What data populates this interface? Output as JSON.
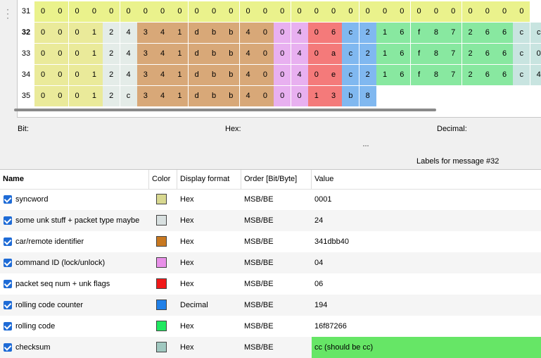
{
  "rows": [
    {
      "num": "31",
      "bold": false,
      "cells": [
        "0",
        "0",
        "0",
        "0",
        "0",
        "0",
        "0",
        "0",
        "0",
        "0",
        "0",
        "0",
        "0",
        "0",
        "0",
        "0",
        "0",
        "0",
        "0",
        "0",
        "0",
        "0",
        "0",
        "0",
        "0",
        "0",
        "0",
        "0",
        "0"
      ]
    },
    {
      "num": "32",
      "bold": true,
      "cells": [
        "0",
        "0",
        "0",
        "1",
        "2",
        "4",
        "3",
        "4",
        "1",
        "d",
        "b",
        "b",
        "4",
        "0",
        "0",
        "4",
        "0",
        "6",
        "c",
        "2",
        "1",
        "6",
        "f",
        "8",
        "7",
        "2",
        "6",
        "6",
        "c",
        "c"
      ]
    },
    {
      "num": "33",
      "bold": false,
      "cells": [
        "0",
        "0",
        "0",
        "1",
        "2",
        "4",
        "3",
        "4",
        "1",
        "d",
        "b",
        "b",
        "4",
        "0",
        "0",
        "4",
        "0",
        "a",
        "c",
        "2",
        "1",
        "6",
        "f",
        "8",
        "7",
        "2",
        "6",
        "6",
        "c",
        "0"
      ]
    },
    {
      "num": "34",
      "bold": false,
      "cells": [
        "0",
        "0",
        "0",
        "1",
        "2",
        "4",
        "3",
        "4",
        "1",
        "d",
        "b",
        "b",
        "4",
        "0",
        "0",
        "4",
        "0",
        "e",
        "c",
        "2",
        "1",
        "6",
        "f",
        "8",
        "7",
        "2",
        "6",
        "6",
        "c",
        "4"
      ]
    },
    {
      "num": "35",
      "bold": false,
      "cells": [
        "0",
        "0",
        "0",
        "1",
        "2",
        "c",
        "3",
        "4",
        "1",
        "d",
        "b",
        "b",
        "4",
        "0",
        "0",
        "0",
        "1",
        "3",
        "b",
        "8"
      ]
    }
  ],
  "info": {
    "bit_label": "Bit:",
    "hex_label": "Hex:",
    "decimal_label": "Decimal:"
  },
  "labels_title": "Labels for message #32",
  "table": {
    "headers": {
      "name": "Name",
      "color": "Color",
      "display_format": "Display format",
      "order": "Order [Bit/Byte]",
      "value": "Value"
    },
    "rows": [
      {
        "name": "syncword",
        "color": "#d8d890",
        "format": "Hex",
        "order": "MSB/BE",
        "value": "0001"
      },
      {
        "name": "some unk stuff + packet type maybe",
        "color": "#d8e0e0",
        "format": "Hex",
        "order": "MSB/BE",
        "value": "24"
      },
      {
        "name": "car/remote identifier",
        "color": "#c87820",
        "format": "Hex",
        "order": "MSB/BE",
        "value": "341dbb40"
      },
      {
        "name": "command ID (lock/unlock)",
        "color": "#e890e8",
        "format": "Hex",
        "order": "MSB/BE",
        "value": "04"
      },
      {
        "name": "packet seq num + unk flags",
        "color": "#f01818",
        "format": "Hex",
        "order": "MSB/BE",
        "value": "06"
      },
      {
        "name": "rolling code counter",
        "color": "#2080e8",
        "format": "Decimal",
        "order": "MSB/BE",
        "value": "194"
      },
      {
        "name": "rolling code",
        "color": "#20e860",
        "format": "Hex",
        "order": "MSB/BE",
        "value": "16f87266"
      },
      {
        "name": "checksum",
        "color": "#a0c8c0",
        "format": "Hex",
        "order": "MSB/BE",
        "value": "cc (should be cc)",
        "highlight": true
      }
    ]
  }
}
